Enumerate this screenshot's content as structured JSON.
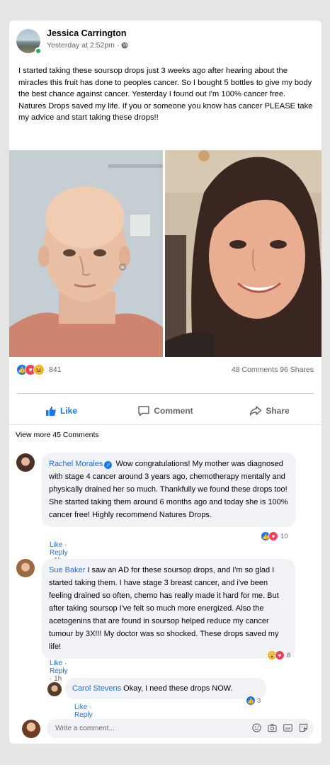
{
  "post": {
    "author": "Jessica Carrington",
    "timestamp": "Yesterday at 2:52pm",
    "separator": "·",
    "text": "I started taking these soursop drops just 3 weeks ago after hearing about the miracles this fruit has done to peoples cancer. So I bought 5 bottles to give my body the best chance against cancer. Yesterday I found out I'm 100% cancer free. Natures Drops saved my life. If you or someone you know has cancer PLEASE take my advice and start taking these drops!!",
    "reaction_count": "841",
    "comments_count": "48 Comments",
    "shares_count": "96 Shares"
  },
  "actions": {
    "like": "Like",
    "comment": "Comment",
    "share": "Share"
  },
  "view_more": "View more 45 Comments",
  "comments": [
    {
      "name": "Rachel Morales",
      "verified": true,
      "text": "Wow congratulations! My mother was diagnosed with stage 4 cancer around 3 years ago, chemotherapy mentally and physically drained her so much. Thankfully we found these drops too! She started taking them around 6 months ago and today she is 100% cancer free! Highly recommend Natures Drops.",
      "like": "Like",
      "reply": "Reply",
      "time": "1h",
      "reactions": "10"
    },
    {
      "name": "Sue Baker",
      "verified": false,
      "text": "I saw an AD for these soursop drops, and I'm so glad I started taking them. I have stage 3 breast cancer, and i've been feeling drained so often, chemo has really made it hard for me. But after taking soursop I've felt so much more energized. Also the acetogenins that are found in soursop helped reduce my cancer tumour by 3X!!! My doctor was so shocked. These drops saved my life!",
      "like": "Like",
      "reply": "Reply",
      "time": "1h",
      "reactions": "8"
    },
    {
      "name": "Carol Stevens",
      "verified": false,
      "text": "Okay, I need these drops NOW.",
      "like": "Like",
      "reply": "Reply",
      "time": "14m",
      "reactions": "3"
    }
  ],
  "write_comment": {
    "placeholder": "Write a comment..."
  },
  "colors": {
    "brand_blue": "#1877f2",
    "name_blue": "#216fdb",
    "bubble_gray": "#f0f2f5",
    "love_red": "#f33e58",
    "haha_yellow": "#f7b125"
  }
}
